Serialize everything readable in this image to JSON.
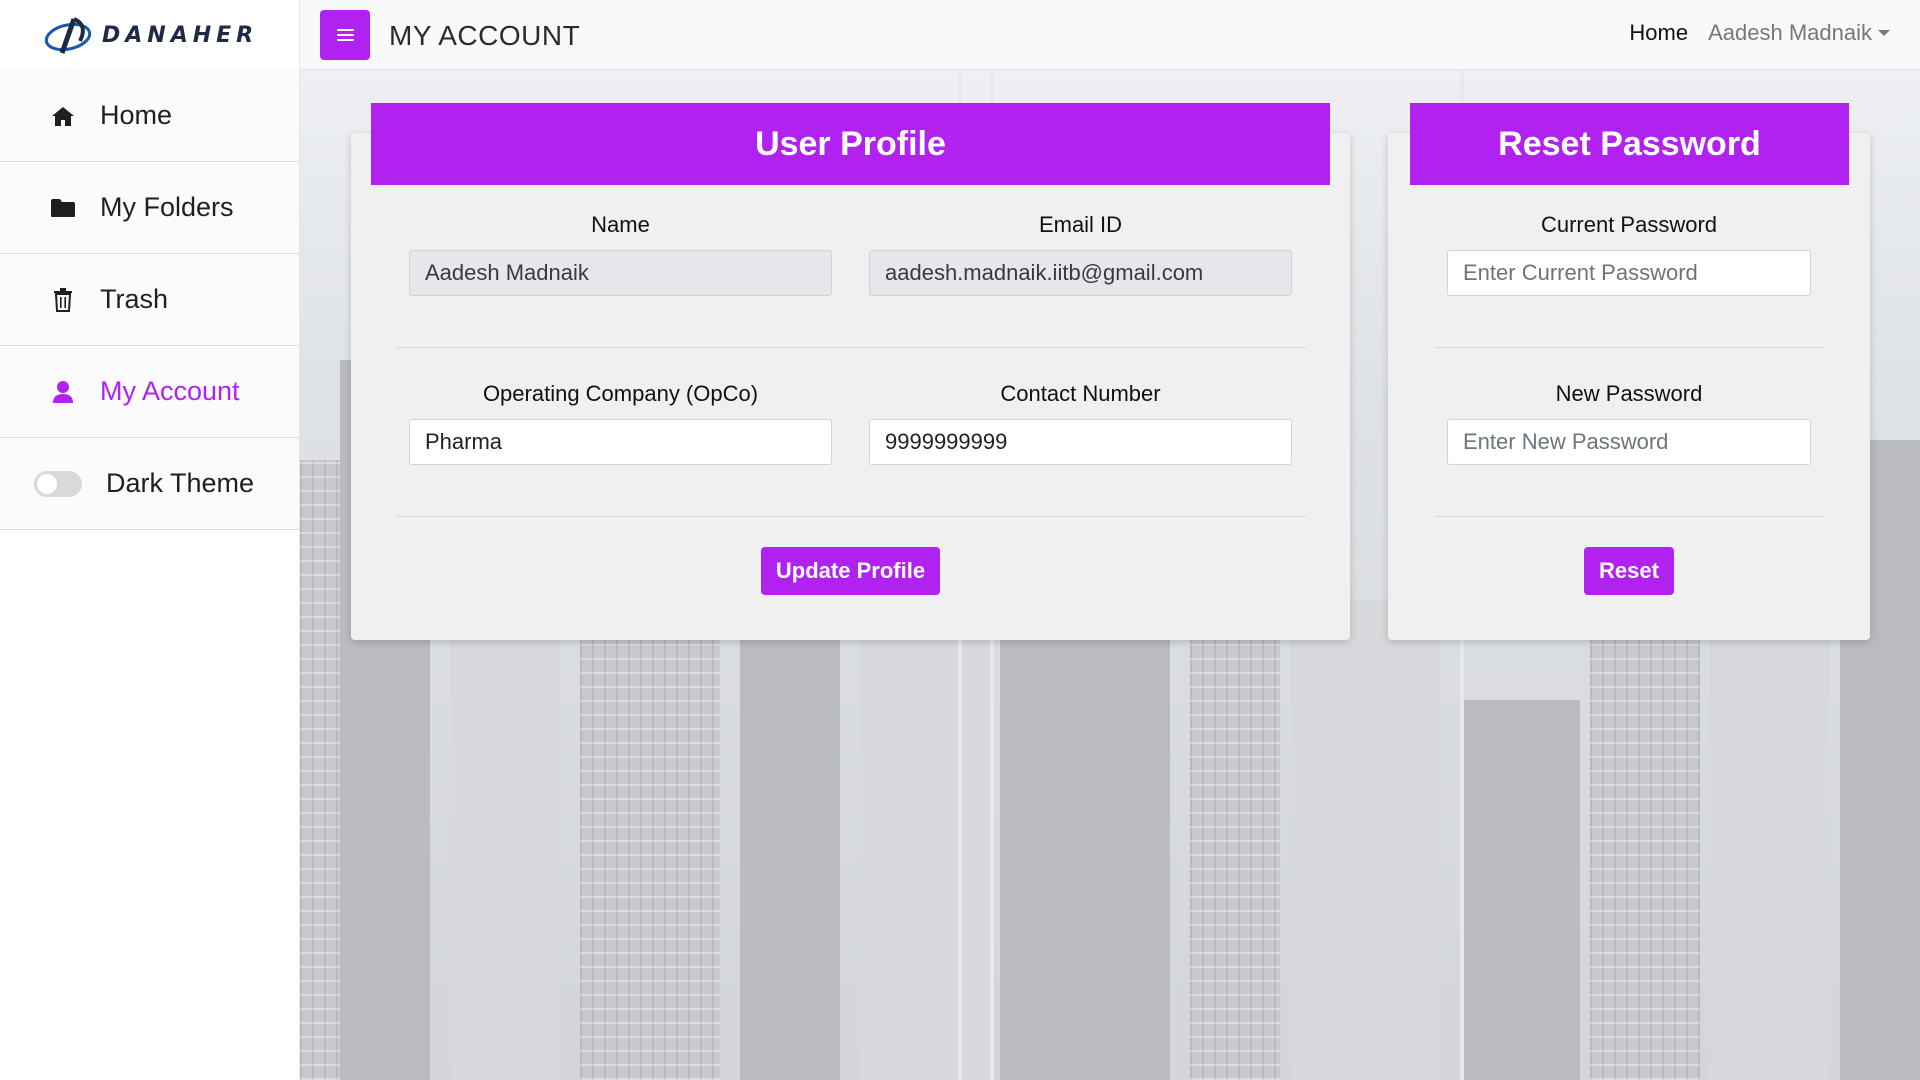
{
  "brand": {
    "name": "DANAHER",
    "logo_icon": "danaher-logo-icon"
  },
  "header": {
    "menu_icon": "hamburger-icon",
    "page_title": "MY ACCOUNT",
    "nav_home": "Home",
    "user_name": "Aadesh Madnaik"
  },
  "sidebar": {
    "items": [
      {
        "label": "Home",
        "icon": "home-icon"
      },
      {
        "label": "My Folders",
        "icon": "folder-icon"
      },
      {
        "label": "Trash",
        "icon": "trash-icon"
      },
      {
        "label": "My Account",
        "icon": "user-icon",
        "active": true
      },
      {
        "label": "Dark Theme",
        "icon": "toggle-switch",
        "toggle_on": false
      }
    ]
  },
  "user_profile": {
    "title": "User Profile",
    "name_label": "Name",
    "name_value": "Aadesh Madnaik",
    "email_label": "Email ID",
    "email_value": "aadesh.madnaik.iitb@gmail.com",
    "opco_label": "Operating Company (OpCo)",
    "opco_value": "Pharma",
    "contact_label": "Contact Number",
    "contact_value": "9999999999",
    "button_label": "Update Profile"
  },
  "reset_password": {
    "title": "Reset Password",
    "current_label": "Current Password",
    "current_placeholder": "Enter Current Password",
    "new_label": "New Password",
    "new_placeholder": "Enter New Password",
    "button_label": "Reset"
  },
  "colors": {
    "accent": "#b122f0",
    "card_bg": "#f0f0f1",
    "sidebar_bg": "#ffffff"
  }
}
